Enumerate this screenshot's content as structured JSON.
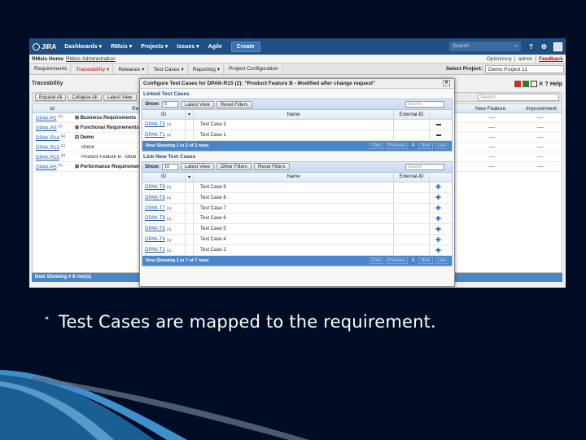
{
  "header": {
    "logo": "JIRA",
    "nav": [
      "Dashboards ▾",
      "RMsis ▾",
      "Projects ▾",
      "Issues ▾",
      "Agile"
    ],
    "create_label": "Create",
    "search_placeholder": "Search"
  },
  "rm_bar": {
    "home": "RMsis Home",
    "admin": "RMsis Administration",
    "right": [
      "Optimizory",
      "admin"
    ],
    "feedback": "Feedback"
  },
  "menu": {
    "items": [
      "Requirements",
      "Traceability ▾",
      "Releases ▾",
      "Test Cases ▾",
      "Reporting ▾",
      "Project Configuration"
    ],
    "active_index": 1,
    "project_label": "Select Project:",
    "project_value": "Demo Project 11"
  },
  "traceability": {
    "title": "Traceability",
    "help_label": "Help",
    "toolbar": {
      "expand": "Expand All",
      "collapse": "Collapse All",
      "latest": "Latest View",
      "search_placeholder": "Search"
    },
    "columns": {
      "id": "Id",
      "req": "Req",
      "new_feature": "New Feature",
      "improvement": "Improvement"
    },
    "rows": [
      {
        "id": "DPAK-R1",
        "ver": "(1)",
        "name": "⊞ Business Requirements",
        "nf": "----",
        "imp": "----"
      },
      {
        "id": "DPAK-R3",
        "ver": "(1)",
        "name": "⊞ Functional Requirements",
        "nf": "----",
        "imp": "----"
      },
      {
        "id": "DPAK-R14",
        "ver": "(1)",
        "name": "⊟ Demo",
        "nf": "----",
        "imp": "----"
      },
      {
        "id": "DPAK-R13",
        "ver": "(1)",
        "name": "check",
        "nf": "----",
        "imp": "----"
      },
      {
        "id": "DPAK-R15",
        "ver": "(2)",
        "name": "Product Feature B - Modi",
        "nf": "----",
        "imp": "----"
      },
      {
        "id": "DPAK-R5",
        "ver": "(1)",
        "name": "⊞ Performance Requirements",
        "nf": "----",
        "imp": "----"
      }
    ],
    "footer": "Now Showing # 6 row(s)"
  },
  "dialog": {
    "title": "Configure Test Cases for DPAK-R15 (2): \"Product Feature B - Modified after change request\"",
    "close": "✕",
    "linked": {
      "section": "Linked Test Cases",
      "show_label": "Show:",
      "show_value": "5",
      "latest": "Latest View",
      "reset": "Reset Filters",
      "search_placeholder": "Search",
      "columns": {
        "id": "ID",
        "name": "Name",
        "ext": "External-ID"
      },
      "rows": [
        {
          "id": "DPAK-T3",
          "ver": "(1)",
          "name": "Test Case 3"
        },
        {
          "id": "DPAK-T1",
          "ver": "(1)",
          "name": "Test Case 1"
        }
      ],
      "footer": "Now Showing 1 to 2 of 2 rows",
      "pager": {
        "first": "First",
        "prev": "Previous",
        "page": "1",
        "next": "Next",
        "last": "Last"
      }
    },
    "unlinked": {
      "section": "Link New Test Cases",
      "show_label": "Show:",
      "show_value": "10",
      "latest": "Latest View",
      "other": "Other Filters",
      "reset": "Reset Filters",
      "search_placeholder": "Search",
      "columns": {
        "id": "ID",
        "name": "Name",
        "ext": "External-ID"
      },
      "rows": [
        {
          "id": "DPAK-T9",
          "ver": "(1)",
          "name": "Test Case 9"
        },
        {
          "id": "DPAK-T8",
          "ver": "(1)",
          "name": "Test Case 8"
        },
        {
          "id": "DPAK-T7",
          "ver": "(1)",
          "name": "Test Case 7"
        },
        {
          "id": "DPAK-T6",
          "ver": "(1)",
          "name": "Test Case 6"
        },
        {
          "id": "DPAK-T5",
          "ver": "(1)",
          "name": "Test Case 5"
        },
        {
          "id": "DPAK-T4",
          "ver": "(1)",
          "name": "Test Case 4"
        },
        {
          "id": "DPAK-T2",
          "ver": "(1)",
          "name": "Test Case 2"
        }
      ],
      "footer": "Now Showing 1 to 7 of 7 rows",
      "pager": {
        "first": "First",
        "prev": "Previous",
        "page": "1",
        "next": "Next",
        "last": "Last"
      }
    }
  },
  "slide": {
    "bullet": "❝",
    "caption": "Test Cases are mapped to the requirement."
  },
  "colors": {
    "header": "#205081",
    "slide_bg": "#000b24",
    "footer_blue": "#4a86c8",
    "swoosh": "#2d7fb8"
  }
}
